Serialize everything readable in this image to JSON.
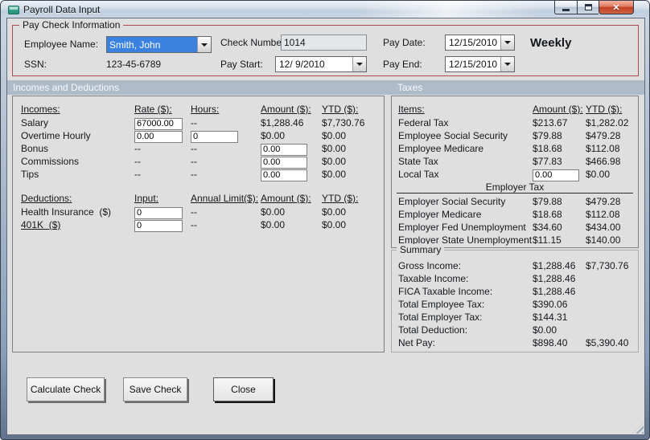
{
  "window": {
    "title": "Payroll Data Input"
  },
  "icons": {
    "titlebar": "form-icon",
    "minimize": "minimize-icon",
    "maximize": "maximize-icon",
    "close": "close-icon",
    "dropdown": "chevron-down-icon",
    "resize": "resize-grip-icon"
  },
  "colors": {
    "paycheck_border": "#b04b4b",
    "section_header_bg": "#aebbc9",
    "selection_blue": "#3b82e0",
    "dialog_bg": "#dfdfdf",
    "close_button_red": "#c03d24"
  },
  "paycheck_info": {
    "title": "Pay Check Information",
    "employee_name_label": "Employee Name:",
    "employee_name_value": "Smith, John",
    "ssn_label": "SSN:",
    "ssn_value": "123-45-6789",
    "check_number_label": "Check Number:",
    "check_number_value": "1014",
    "pay_start_label": "Pay Start:",
    "pay_start_value": "12/ 9/2010",
    "pay_date_label": "Pay Date:",
    "pay_date_value": "12/15/2010",
    "pay_end_label": "Pay End:",
    "pay_end_value": "12/15/2010",
    "frequency": "Weekly"
  },
  "sections": {
    "incomes_deductions": "Incomes and Deductions",
    "taxes": "Taxes"
  },
  "incomes": {
    "headers": [
      "Incomes:",
      "Rate ($):",
      "Hours:",
      "Amount ($):",
      "YTD ($):"
    ],
    "rows": [
      {
        "label": "Salary",
        "cells": [
          {
            "v": "67000.00",
            "input": true
          },
          {
            "v": "--"
          },
          {
            "v": "$1,288.46"
          },
          {
            "v": "$7,730.76"
          }
        ]
      },
      {
        "label": "Overtime Hourly",
        "cells": [
          {
            "v": "0.00",
            "input": true
          },
          {
            "v": "0",
            "input": true
          },
          {
            "v": "$0.00"
          },
          {
            "v": "$0.00"
          }
        ]
      },
      {
        "label": "Bonus",
        "cells": [
          {
            "v": "--"
          },
          {
            "v": "--"
          },
          {
            "v": "0.00",
            "input": true
          },
          {
            "v": "$0.00"
          }
        ]
      },
      {
        "label": "Commissions",
        "cells": [
          {
            "v": "--"
          },
          {
            "v": "--"
          },
          {
            "v": "0.00",
            "input": true
          },
          {
            "v": "$0.00"
          }
        ]
      },
      {
        "label": "Tips",
        "cells": [
          {
            "v": "--"
          },
          {
            "v": "--"
          },
          {
            "v": "0.00",
            "input": true
          },
          {
            "v": "$0.00"
          }
        ]
      }
    ]
  },
  "deductions": {
    "headers": [
      "Deductions:",
      "Input:",
      "Annual Limit($):",
      "Amount ($):",
      "YTD ($):"
    ],
    "rows": [
      {
        "label": "Health Insurance  ($)",
        "underline": false,
        "cells": [
          {
            "v": "0",
            "input": true
          },
          {
            "v": "--"
          },
          {
            "v": "$0.00"
          },
          {
            "v": "$0.00"
          }
        ]
      },
      {
        "label": "401K  ($)",
        "underline": true,
        "cells": [
          {
            "v": "0",
            "input": true
          },
          {
            "v": "--"
          },
          {
            "v": "$0.00"
          },
          {
            "v": "$0.00"
          }
        ]
      }
    ]
  },
  "taxes": {
    "headers": [
      "Items:",
      "Amount ($):",
      "YTD ($):"
    ],
    "employee_rows": [
      {
        "label": "Federal Tax",
        "amount": "$213.67",
        "ytd": "$1,282.02"
      },
      {
        "label": "Employee Social Security",
        "amount": "$79.88",
        "ytd": "$479.28"
      },
      {
        "label": "Employee Medicare",
        "amount": "$18.68",
        "ytd": "$112.08"
      },
      {
        "label": "State Tax",
        "amount": "$77.83",
        "ytd": "$466.98"
      },
      {
        "label": "Local Tax",
        "amount": "0.00",
        "amount_input": true,
        "ytd": "$0.00"
      }
    ],
    "employer_header": "Employer Tax",
    "employer_rows": [
      {
        "label": "Employer Social Security",
        "amount": "$79.88",
        "ytd": "$479.28"
      },
      {
        "label": "Employer Medicare",
        "amount": "$18.68",
        "ytd": "$112.08"
      },
      {
        "label": "Employer Fed Unemployment",
        "amount": "$34.60",
        "ytd": "$434.00"
      },
      {
        "label": "Employer State Unemployment",
        "amount": "$11.15",
        "ytd": "$140.00"
      }
    ]
  },
  "summary": {
    "title": "Summary",
    "rows": [
      {
        "label": "Gross Income:",
        "amount": "$1,288.46",
        "ytd": "$7,730.76"
      },
      {
        "label": "Taxable Income:",
        "amount": "$1,288.46",
        "ytd": ""
      },
      {
        "label": "FICA Taxable Income:",
        "amount": "$1,288.46",
        "ytd": ""
      },
      {
        "label": "Total Employee Tax:",
        "amount": "$390.06",
        "ytd": ""
      },
      {
        "label": "Total Employer Tax:",
        "amount": "$144.31",
        "ytd": ""
      },
      {
        "label": "Total Deduction:",
        "amount": "$0.00",
        "ytd": ""
      },
      {
        "label": "Net Pay:",
        "amount": "$898.40",
        "ytd": "$5,390.40"
      }
    ]
  },
  "buttons": {
    "calculate": "Calculate Check",
    "save": "Save Check",
    "close": "Close"
  }
}
